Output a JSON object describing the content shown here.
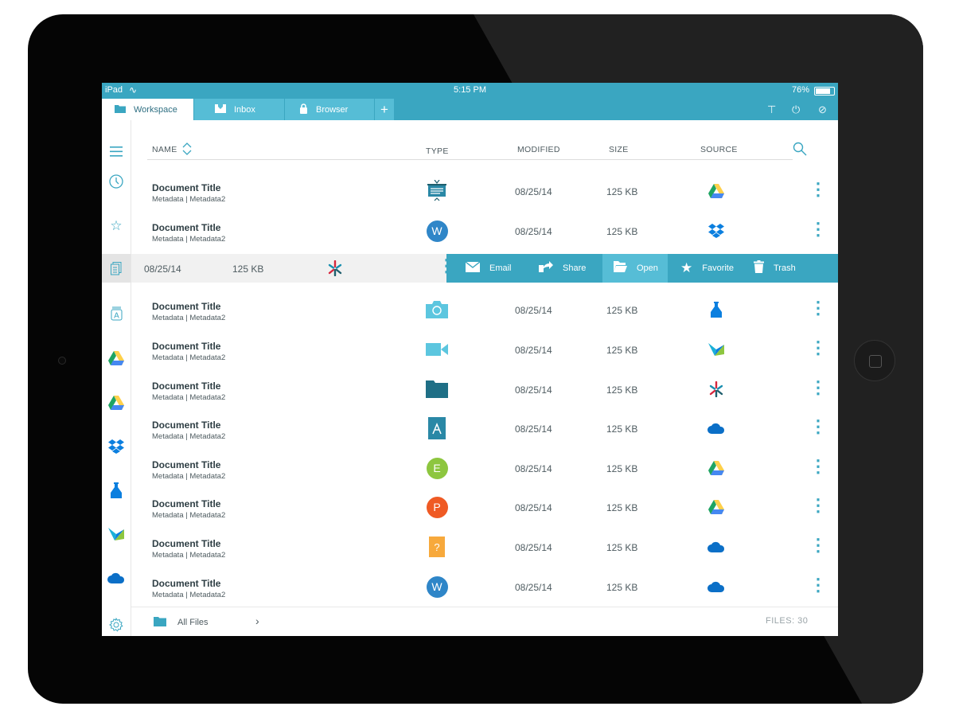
{
  "status_bar": {
    "carrier": "iPad",
    "time": "5:15 PM",
    "battery": "76%",
    "battery_level": 0.76
  },
  "tabs": [
    {
      "label": "Workspace",
      "icon": "folder-icon",
      "active": true
    },
    {
      "label": "Inbox",
      "icon": "inbox-icon",
      "active": false
    },
    {
      "label": "Browser",
      "icon": "lock-icon",
      "active": false
    }
  ],
  "toolbar_icons": [
    "pin-icon",
    "power-icon",
    "timer-icon"
  ],
  "rail": [
    "menu-icon",
    "clock-icon",
    "star-icon",
    "documents-icon",
    "app-store-icon",
    "google-drive-icon",
    "google-drive-icon",
    "dropbox-icon",
    "box-icon",
    "cloud-service-icon",
    "onedrive-icon",
    "settings-icon"
  ],
  "columns": {
    "name": "NAME",
    "type": "TYPE",
    "modified": "MODIFIED",
    "size": "SIZE",
    "source": "SOURCE"
  },
  "rows": [
    {
      "title": "Document Title",
      "meta": "Metadata | Metadata2",
      "type": "presentation",
      "modified": "08/25/14",
      "size": "125 KB",
      "source": "google-drive"
    },
    {
      "title": "Document Title",
      "meta": "Metadata | Metadata2",
      "type": "word",
      "type_letter": "W",
      "modified": "08/25/14",
      "size": "125 KB",
      "source": "dropbox"
    },
    {
      "title": "Document Title",
      "meta": "Metadata | Metadata2",
      "type": "photo",
      "modified": "08/25/14",
      "size": "125 KB",
      "source": "box"
    },
    {
      "title": "Document Title",
      "meta": "Metadata | Metadata2",
      "type": "video",
      "modified": "08/25/14",
      "size": "125 KB",
      "source": "cloud-service"
    },
    {
      "title": "Document Title",
      "meta": "Metadata | Metadata2",
      "type": "folder",
      "modified": "08/25/14",
      "size": "125 KB",
      "source": "sharepoint"
    },
    {
      "title": "Document Title",
      "meta": "Metadata | Metadata2",
      "type": "pdf",
      "modified": "08/25/14",
      "size": "125 KB",
      "source": "onedrive"
    },
    {
      "title": "Document Title",
      "meta": "Metadata | Metadata2",
      "type": "spreadsheet",
      "type_letter": "E",
      "modified": "08/25/14",
      "size": "125 KB",
      "source": "google-drive"
    },
    {
      "title": "Document Title",
      "meta": "Metadata | Metadata2",
      "type": "powerpoint",
      "type_letter": "P",
      "modified": "08/25/14",
      "size": "125 KB",
      "source": "google-drive"
    },
    {
      "title": "Document Title",
      "meta": "Metadata | Metadata2",
      "type": "unknown",
      "type_letter": "?",
      "modified": "08/25/14",
      "size": "125 KB",
      "source": "onedrive"
    },
    {
      "title": "Document Title",
      "meta": "Metadata | Metadata2",
      "type": "word",
      "type_letter": "W",
      "modified": "08/25/14",
      "size": "125 KB",
      "source": "onedrive"
    }
  ],
  "selected_row": {
    "modified": "08/25/14",
    "size": "125 KB",
    "source": "sharepoint",
    "actions": [
      {
        "label": "Email",
        "icon": "mail-icon"
      },
      {
        "label": "Share",
        "icon": "share-icon"
      },
      {
        "label": "Open",
        "icon": "open-folder-icon"
      },
      {
        "label": "Favorite",
        "icon": "star-icon"
      },
      {
        "label": "Trash",
        "icon": "trash-icon"
      }
    ]
  },
  "footer": {
    "label": "All Files",
    "files_count": "FILES: 30"
  },
  "colors": {
    "accent": "#3aa6c1",
    "tab_inactive": "#56bdd6",
    "word": "#2f86c8",
    "excel": "#8dc63f",
    "powerpoint": "#ef5a24",
    "unknown": "#f7a93c",
    "google_drive_green": "#1fa463",
    "google_drive_yellow": "#ffd04b",
    "google_drive_blue": "#4688f1",
    "dropbox": "#0b7fdf"
  }
}
